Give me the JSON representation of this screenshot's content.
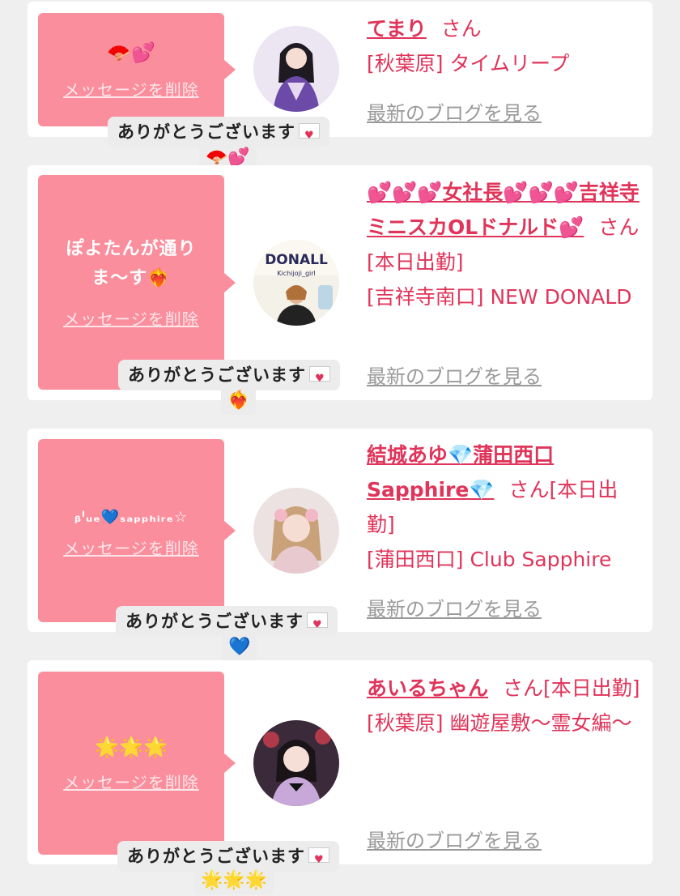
{
  "items": [
    {
      "bubble_text": "",
      "bubble_emoji": "🪭💕",
      "delete_label": "メッセージを削除",
      "name": "てまり",
      "name_suffix": "さん",
      "location": "[秋葉原] タイムリープ",
      "blog_link": "最新のブログを見る",
      "thanks_text": "ありがとうございます",
      "thanks_emoji": "🪭💕",
      "avatar_colors": [
        "#d9c9f0",
        "#6b4aa8"
      ]
    },
    {
      "bubble_text": "ぽよたんが通りま〜す❤️‍🔥",
      "bubble_emoji": "",
      "delete_label": "メッセージを削除",
      "name": "💕💕💕女社長💕💕💕吉祥寺ミニスカOLドナルド💕",
      "name_suffix": "さん[本日出勤]",
      "location": "[吉祥寺南口] NEW DONALD",
      "blog_link": "最新のブログを見る",
      "thanks_text": "ありがとうございます",
      "thanks_emoji": "❤️‍🔥",
      "avatar_label": "DONALL",
      "avatar_sublabel": "Kichijoji_girl",
      "avatar_colors": [
        "#f4f1e8",
        "#333333"
      ]
    },
    {
      "bubble_text": "ᵦˡᵤₑ💙ₛₐₚₚₕᵢᵣₑ☆",
      "bubble_emoji": "",
      "delete_label": "メッセージを削除",
      "name": "結城あゆ💎蒲田西口Sapphire💎",
      "name_suffix": "さん[本日出勤]",
      "location": "[蒲田西口] Club Sapphire",
      "blog_link": "最新のブログを見る",
      "thanks_text": "ありがとうございます",
      "thanks_emoji": "💙",
      "avatar_colors": [
        "#e9dcdc",
        "#c9a27a"
      ]
    },
    {
      "bubble_text": "",
      "bubble_emoji": "🌟🌟🌟",
      "delete_label": "メッセージを削除",
      "name": "あいるちゃん",
      "name_suffix": "さん[本日出勤]",
      "location": "[秋葉原] 幽遊屋敷〜霊女編〜",
      "blog_link": "最新のブログを見る",
      "thanks_text": "ありがとうございます",
      "thanks_emoji": "🌟🌟🌟",
      "avatar_colors": [
        "#3a2a3a",
        "#c8a8d8"
      ]
    }
  ],
  "colors": {
    "bubble": "#fb8e9c",
    "accent": "#e0345a",
    "link_gray": "#9a9a9a",
    "page_bg": "#efefef"
  }
}
